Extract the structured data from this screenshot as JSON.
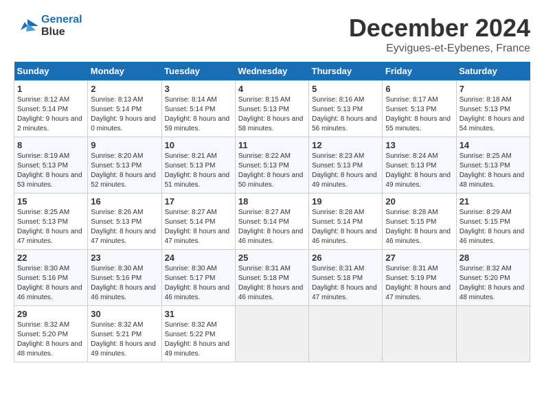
{
  "header": {
    "logo_line1": "General",
    "logo_line2": "Blue",
    "month_title": "December 2024",
    "location": "Eyvigues-et-Eybenes, France"
  },
  "weekdays": [
    "Sunday",
    "Monday",
    "Tuesday",
    "Wednesday",
    "Thursday",
    "Friday",
    "Saturday"
  ],
  "weeks": [
    [
      {
        "day": 1,
        "sunrise": "8:12 AM",
        "sunset": "5:14 PM",
        "daylight": "9 hours and 2 minutes."
      },
      {
        "day": 2,
        "sunrise": "8:13 AM",
        "sunset": "5:14 PM",
        "daylight": "9 hours and 0 minutes."
      },
      {
        "day": 3,
        "sunrise": "8:14 AM",
        "sunset": "5:14 PM",
        "daylight": "8 hours and 59 minutes."
      },
      {
        "day": 4,
        "sunrise": "8:15 AM",
        "sunset": "5:13 PM",
        "daylight": "8 hours and 58 minutes."
      },
      {
        "day": 5,
        "sunrise": "8:16 AM",
        "sunset": "5:13 PM",
        "daylight": "8 hours and 56 minutes."
      },
      {
        "day": 6,
        "sunrise": "8:17 AM",
        "sunset": "5:13 PM",
        "daylight": "8 hours and 55 minutes."
      },
      {
        "day": 7,
        "sunrise": "8:18 AM",
        "sunset": "5:13 PM",
        "daylight": "8 hours and 54 minutes."
      }
    ],
    [
      {
        "day": 8,
        "sunrise": "8:19 AM",
        "sunset": "5:13 PM",
        "daylight": "8 hours and 53 minutes."
      },
      {
        "day": 9,
        "sunrise": "8:20 AM",
        "sunset": "5:13 PM",
        "daylight": "8 hours and 52 minutes."
      },
      {
        "day": 10,
        "sunrise": "8:21 AM",
        "sunset": "5:13 PM",
        "daylight": "8 hours and 51 minutes."
      },
      {
        "day": 11,
        "sunrise": "8:22 AM",
        "sunset": "5:13 PM",
        "daylight": "8 hours and 50 minutes."
      },
      {
        "day": 12,
        "sunrise": "8:23 AM",
        "sunset": "5:13 PM",
        "daylight": "8 hours and 49 minutes."
      },
      {
        "day": 13,
        "sunrise": "8:24 AM",
        "sunset": "5:13 PM",
        "daylight": "8 hours and 49 minutes."
      },
      {
        "day": 14,
        "sunrise": "8:25 AM",
        "sunset": "5:13 PM",
        "daylight": "8 hours and 48 minutes."
      }
    ],
    [
      {
        "day": 15,
        "sunrise": "8:25 AM",
        "sunset": "5:13 PM",
        "daylight": "8 hours and 47 minutes."
      },
      {
        "day": 16,
        "sunrise": "8:26 AM",
        "sunset": "5:13 PM",
        "daylight": "8 hours and 47 minutes."
      },
      {
        "day": 17,
        "sunrise": "8:27 AM",
        "sunset": "5:14 PM",
        "daylight": "8 hours and 47 minutes."
      },
      {
        "day": 18,
        "sunrise": "8:27 AM",
        "sunset": "5:14 PM",
        "daylight": "8 hours and 46 minutes."
      },
      {
        "day": 19,
        "sunrise": "8:28 AM",
        "sunset": "5:14 PM",
        "daylight": "8 hours and 46 minutes."
      },
      {
        "day": 20,
        "sunrise": "8:28 AM",
        "sunset": "5:15 PM",
        "daylight": "8 hours and 46 minutes."
      },
      {
        "day": 21,
        "sunrise": "8:29 AM",
        "sunset": "5:15 PM",
        "daylight": "8 hours and 46 minutes."
      }
    ],
    [
      {
        "day": 22,
        "sunrise": "8:30 AM",
        "sunset": "5:16 PM",
        "daylight": "8 hours and 46 minutes."
      },
      {
        "day": 23,
        "sunrise": "8:30 AM",
        "sunset": "5:16 PM",
        "daylight": "8 hours and 46 minutes."
      },
      {
        "day": 24,
        "sunrise": "8:30 AM",
        "sunset": "5:17 PM",
        "daylight": "8 hours and 46 minutes."
      },
      {
        "day": 25,
        "sunrise": "8:31 AM",
        "sunset": "5:18 PM",
        "daylight": "8 hours and 46 minutes."
      },
      {
        "day": 26,
        "sunrise": "8:31 AM",
        "sunset": "5:18 PM",
        "daylight": "8 hours and 47 minutes."
      },
      {
        "day": 27,
        "sunrise": "8:31 AM",
        "sunset": "5:19 PM",
        "daylight": "8 hours and 47 minutes."
      },
      {
        "day": 28,
        "sunrise": "8:32 AM",
        "sunset": "5:20 PM",
        "daylight": "8 hours and 48 minutes."
      }
    ],
    [
      {
        "day": 29,
        "sunrise": "8:32 AM",
        "sunset": "5:20 PM",
        "daylight": "8 hours and 48 minutes."
      },
      {
        "day": 30,
        "sunrise": "8:32 AM",
        "sunset": "5:21 PM",
        "daylight": "8 hours and 49 minutes."
      },
      {
        "day": 31,
        "sunrise": "8:32 AM",
        "sunset": "5:22 PM",
        "daylight": "8 hours and 49 minutes."
      },
      null,
      null,
      null,
      null
    ]
  ]
}
